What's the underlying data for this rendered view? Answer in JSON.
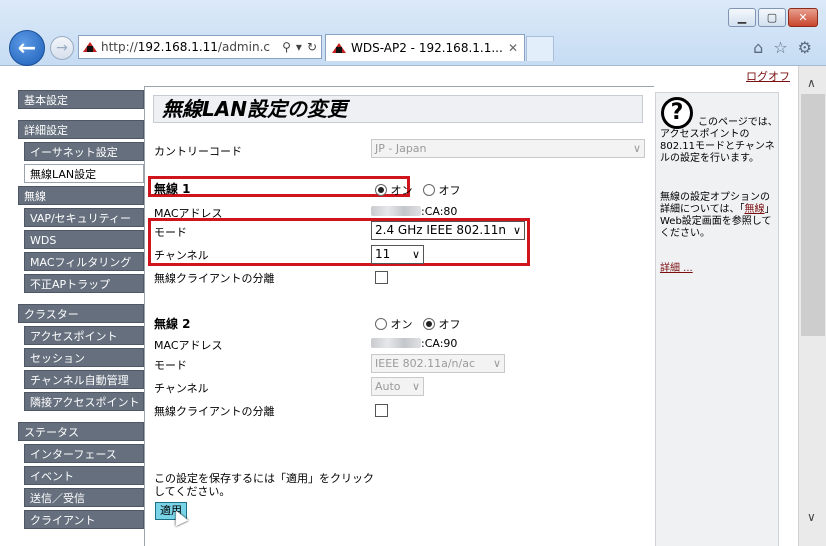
{
  "browser": {
    "url_prefix": "http://",
    "url_host": "192.168.1.11",
    "url_rest": "/admin.c",
    "tab_title": "WDS-AP2 - 192.168.1.1...",
    "tab_close": "✕"
  },
  "page": {
    "logout": "ログオフ",
    "title": "無線LAN設定の変更"
  },
  "sidebar": {
    "groups": [
      {
        "header": "基本設定",
        "items": []
      },
      {
        "header": "詳細設定",
        "items": [
          "イーサネット設定",
          "無線LAN設定"
        ]
      },
      {
        "header": "無線",
        "items": [
          "VAP/セキュリティー",
          "WDS",
          "MACフィルタリング",
          "不正APトラップ"
        ]
      },
      {
        "header": "クラスター",
        "items": [
          "アクセスポイント",
          "セッション",
          "チャンネル自動管理",
          "隣接アクセスポイント"
        ]
      },
      {
        "header": "ステータス",
        "items": [
          "インターフェース",
          "イベント",
          "送信／受信",
          "クライアント"
        ]
      }
    ],
    "active": "無線LAN設定"
  },
  "form": {
    "country_label": "カントリーコード",
    "country_value": "JP - Japan",
    "radio1": {
      "title": "無線 1",
      "on_label": "オン",
      "off_label": "オフ",
      "on": true,
      "mac_label": "MACアドレス",
      "mac_suffix": ":CA:80",
      "mode_label": "モード",
      "mode_value": "2.4 GHz IEEE 802.11n",
      "channel_label": "チャンネル",
      "channel_value": "11",
      "isolation_label": "無線クライアントの分離",
      "isolation_checked": false
    },
    "radio2": {
      "title": "無線 2",
      "on_label": "オン",
      "off_label": "オフ",
      "on": false,
      "mac_label": "MACアドレス",
      "mac_suffix": ":CA:90",
      "mode_label": "モード",
      "mode_value": "IEEE 802.11a/n/ac",
      "channel_label": "チャンネル",
      "channel_value": "Auto",
      "isolation_label": "無線クライアントの分離",
      "isolation_checked": false
    },
    "apply_note": "この設定を保存するには「適用」をクリックしてください。",
    "apply_label": "適用"
  },
  "help": {
    "text1": "このページでは、アクセスポイントの802.11モードとチャンネルの設定を行います。",
    "text2_pre": "無線の設定オプションの詳細については、「",
    "text2_link": "無線",
    "text2_post": "」Web設定画面を参照してください。",
    "more": "詳細 ..."
  },
  "colors": {
    "highlight": "#d0141b",
    "sidebar_bg": "#656f7d",
    "apply_bg": "#7ad4e8",
    "link": "#7a1010"
  }
}
